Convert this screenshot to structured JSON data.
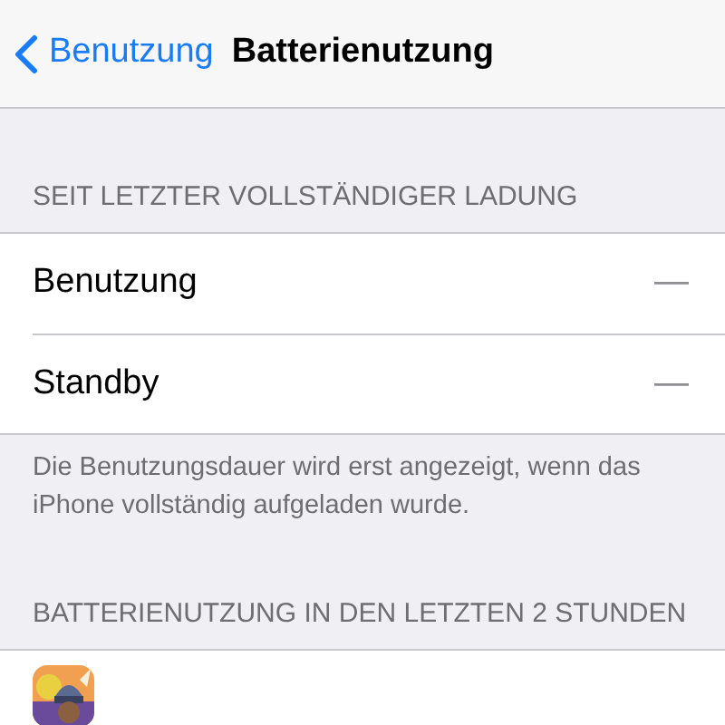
{
  "nav": {
    "back": "Benutzung",
    "title": "Batterienutzung"
  },
  "sections": [
    {
      "header": "SEIT LETZTER VOLLSTÄNDIGER LADUNG",
      "rows": [
        {
          "label": "Benutzung",
          "value": "—"
        },
        {
          "label": "Standby",
          "value": "—"
        }
      ],
      "footer": "Die Benutzungsdauer wird erst angezeigt, wenn das iPhone vollständig aufgeladen wurde."
    },
    {
      "header": "BATTERIENUTZUNG IN DEN LETZTEN 2 STUNDEN"
    }
  ]
}
